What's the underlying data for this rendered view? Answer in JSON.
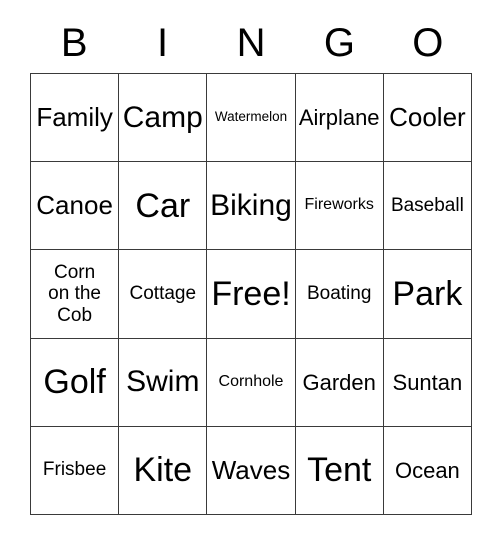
{
  "card": {
    "title": "BINGO",
    "headers": [
      "B",
      "I",
      "N",
      "G",
      "O"
    ],
    "free_space_label": "Free!",
    "rows": [
      [
        {
          "label": "Family",
          "size": "xl"
        },
        {
          "label": "Camp",
          "size": "xxl"
        },
        {
          "label": "Watermelon",
          "size": "xs"
        },
        {
          "label": "Airplane",
          "size": "l"
        },
        {
          "label": "Cooler",
          "size": "xl"
        }
      ],
      [
        {
          "label": "Canoe",
          "size": "xl"
        },
        {
          "label": "Car",
          "size": "3xl"
        },
        {
          "label": "Biking",
          "size": "xxl"
        },
        {
          "label": "Fireworks",
          "size": "s"
        },
        {
          "label": "Baseball",
          "size": "m"
        }
      ],
      [
        {
          "label": "Corn on the Cob",
          "size": "m",
          "multiline": true
        },
        {
          "label": "Cottage",
          "size": "m"
        },
        {
          "label": "Free!",
          "size": "3xl"
        },
        {
          "label": "Boating",
          "size": "m"
        },
        {
          "label": "Park",
          "size": "3xl"
        }
      ],
      [
        {
          "label": "Golf",
          "size": "3xl"
        },
        {
          "label": "Swim",
          "size": "xxl"
        },
        {
          "label": "Cornhole",
          "size": "s"
        },
        {
          "label": "Garden",
          "size": "l"
        },
        {
          "label": "Suntan",
          "size": "l"
        }
      ],
      [
        {
          "label": "Frisbee",
          "size": "m"
        },
        {
          "label": "Kite",
          "size": "3xl"
        },
        {
          "label": "Waves",
          "size": "xl"
        },
        {
          "label": "Tent",
          "size": "3xl"
        },
        {
          "label": "Ocean",
          "size": "l"
        }
      ]
    ]
  },
  "style": {
    "background_color": "#ffffff",
    "text_color": "#000000",
    "border_color": "#3a3a3a"
  }
}
